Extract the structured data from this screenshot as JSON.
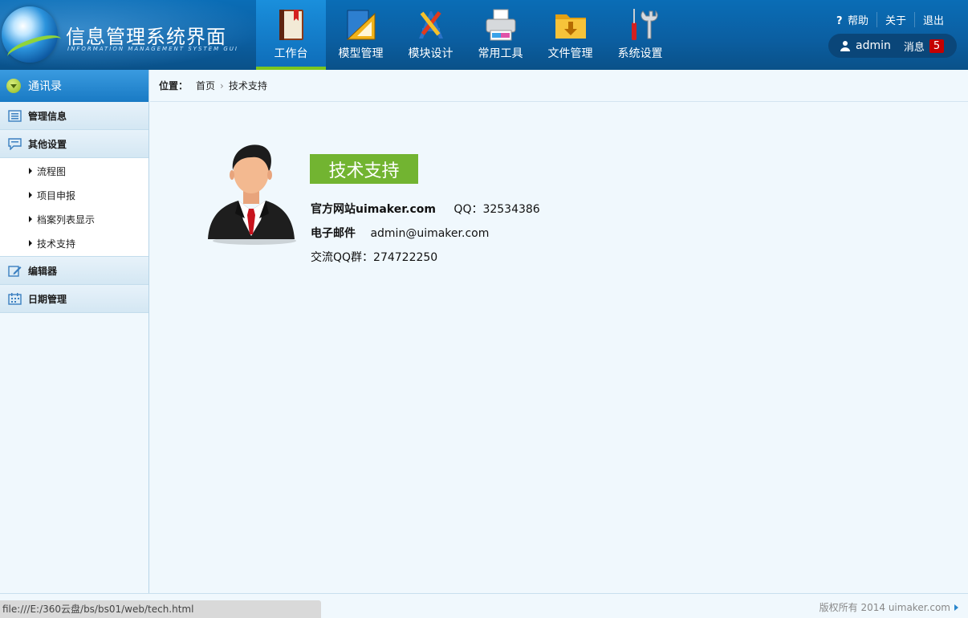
{
  "header": {
    "logo_title": "信息管理系统界面",
    "logo_subtitle": "INFORMATION MANAGEMENT SYSTEM GUI",
    "nav": [
      {
        "label": "工作台",
        "icon": "book-icon",
        "active": true
      },
      {
        "label": "模型管理",
        "icon": "ruler-icon",
        "active": false
      },
      {
        "label": "模块设计",
        "icon": "design-tools-icon",
        "active": false
      },
      {
        "label": "常用工具",
        "icon": "printer-icon",
        "active": false
      },
      {
        "label": "文件管理",
        "icon": "folder-icon",
        "active": false
      },
      {
        "label": "系统设置",
        "icon": "wrench-icon",
        "active": false
      }
    ],
    "links": {
      "help": "帮助",
      "about": "关于",
      "logout": "退出"
    },
    "user": {
      "name": "admin",
      "message_label": "消息",
      "message_count": "5"
    }
  },
  "sidebar": {
    "title": "通讯录",
    "sections": {
      "manage_info": "管理信息",
      "other_settings": "其他设置",
      "editor": "编辑器",
      "date_manage": "日期管理"
    },
    "sub_items": [
      "流程图",
      "项目申报",
      "档案列表显示",
      "技术支持"
    ]
  },
  "breadcrumb": {
    "label": "位置：",
    "home": "首页",
    "current": "技术支持"
  },
  "content": {
    "badge": "技术支持",
    "site_label": "官方网站uimaker.com",
    "qq": "QQ：32534386",
    "email_label": "电子邮件",
    "email": "admin@uimaker.com",
    "group": "交流QQ群：274722250"
  },
  "footer": {
    "status_url": "file:///E:/360云盘/bs/bs01/web/tech.html",
    "copyright": "版权所有 2014 uimaker.com"
  },
  "colors": {
    "accent_green": "#72b431",
    "header_blue": "#0b5fa2",
    "badge_red": "#c40000"
  }
}
